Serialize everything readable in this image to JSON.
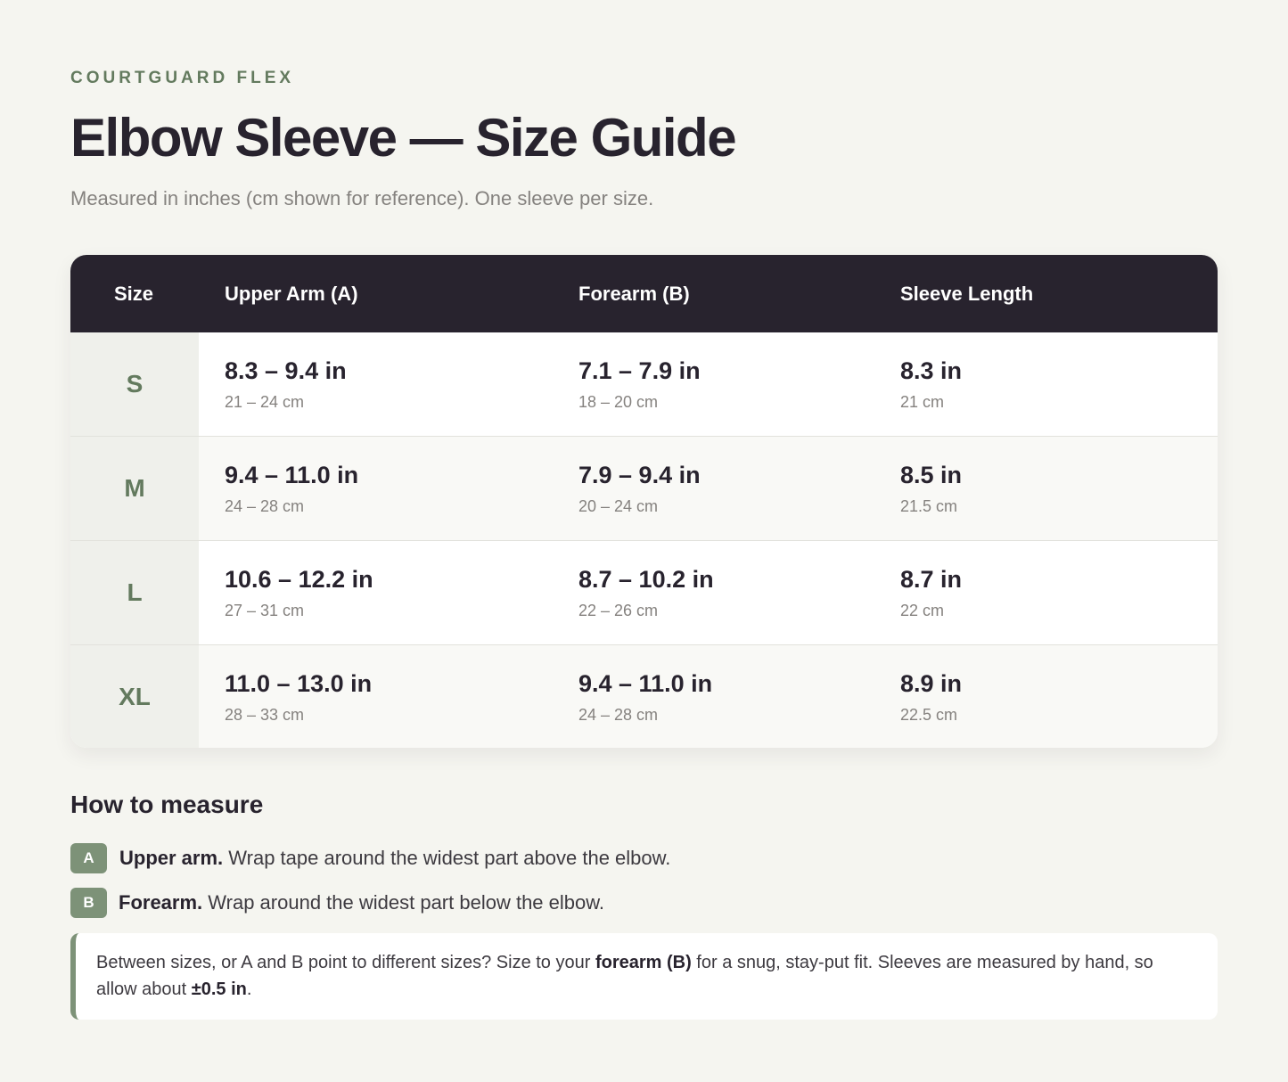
{
  "header": {
    "brand": "COURTGUARD FLEX",
    "title": "Elbow Sleeve — Size Guide",
    "subtitle": "Measured in inches (cm shown for reference). One sleeve per size."
  },
  "table": {
    "columns": [
      "Size",
      "Upper Arm (A)",
      "Forearm (B)",
      "Sleeve Length"
    ],
    "rows": [
      {
        "size": "S",
        "upper_in": "8.3 – 9.4 in",
        "upper_cm": "21 – 24 cm",
        "fore_in": "7.1 – 7.9 in",
        "fore_cm": "18 – 20 cm",
        "len_in": "8.3 in",
        "len_cm": "21 cm"
      },
      {
        "size": "M",
        "upper_in": "9.4 – 11.0 in",
        "upper_cm": "24 – 28 cm",
        "fore_in": "7.9 – 9.4 in",
        "fore_cm": "20 – 24 cm",
        "len_in": "8.5 in",
        "len_cm": "21.5 cm"
      },
      {
        "size": "L",
        "upper_in": "10.6 – 12.2 in",
        "upper_cm": "27 – 31 cm",
        "fore_in": "8.7 – 10.2 in",
        "fore_cm": "22 – 26 cm",
        "len_in": "8.7 in",
        "len_cm": "22 cm"
      },
      {
        "size": "XL",
        "upper_in": "11.0 – 13.0 in",
        "upper_cm": "28 – 33 cm",
        "fore_in": "9.4 – 11.0 in",
        "fore_cm": "24 – 28 cm",
        "len_in": "8.9 in",
        "len_cm": "22.5 cm"
      }
    ]
  },
  "howto": {
    "title": "How to measure",
    "steps": [
      {
        "badge": "A",
        "label": "Upper arm.",
        "text": "Wrap tape around the widest part above the elbow."
      },
      {
        "badge": "B",
        "label": "Forearm.",
        "text": "Wrap around the widest part below the elbow."
      }
    ]
  },
  "note": {
    "part1": "Between sizes, or A and B point to different sizes? Size to your ",
    "bold1": "forearm (B)",
    "part2": " for a snug, stay-put fit. Sleeves are measured by hand, so allow about ",
    "bold2": "±0.5 in",
    "part3": "."
  },
  "colors": {
    "background": "#f5f5f0",
    "header_dark": "#28232e",
    "accent_green": "#637a5e",
    "badge_green": "#7d9278",
    "muted_text": "#85827f"
  }
}
